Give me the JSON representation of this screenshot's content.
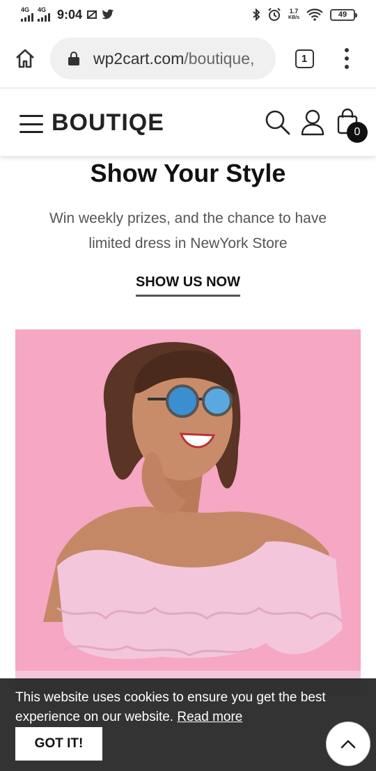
{
  "status_bar": {
    "time": "9:04",
    "network1": "4G",
    "network2": "4G",
    "speed_value": "1.7",
    "speed_unit": "KB/s",
    "battery": "49"
  },
  "browser": {
    "url_domain": "wp2cart.com",
    "url_path": "/boutique,",
    "tab_count": "1"
  },
  "site_header": {
    "logo": "BOUTIQE",
    "cart_count": "0"
  },
  "hero": {
    "title": "Show Your Style",
    "subtitle": "Win weekly prizes, and the chance to have limited dress in NewYork Store",
    "cta": "SHOW US NOW"
  },
  "cookie_bar": {
    "message": "This website uses cookies to ensure you get the best experience on our website.",
    "read_more": "Read more",
    "accept_label": "GOT IT!"
  },
  "colors": {
    "hero_bg": "#f6a7c4",
    "cookie_bg": "#282828",
    "cart_badge": "#111111"
  },
  "icons": {
    "home": "home-icon",
    "lock": "lock-icon",
    "tabs": "tab-switcher-icon",
    "menu": "kebab-menu-icon",
    "hamburger": "hamburger-icon",
    "search": "search-icon",
    "account": "user-icon",
    "cart": "shopping-bag-icon",
    "scroll_top": "chevron-up-icon"
  }
}
